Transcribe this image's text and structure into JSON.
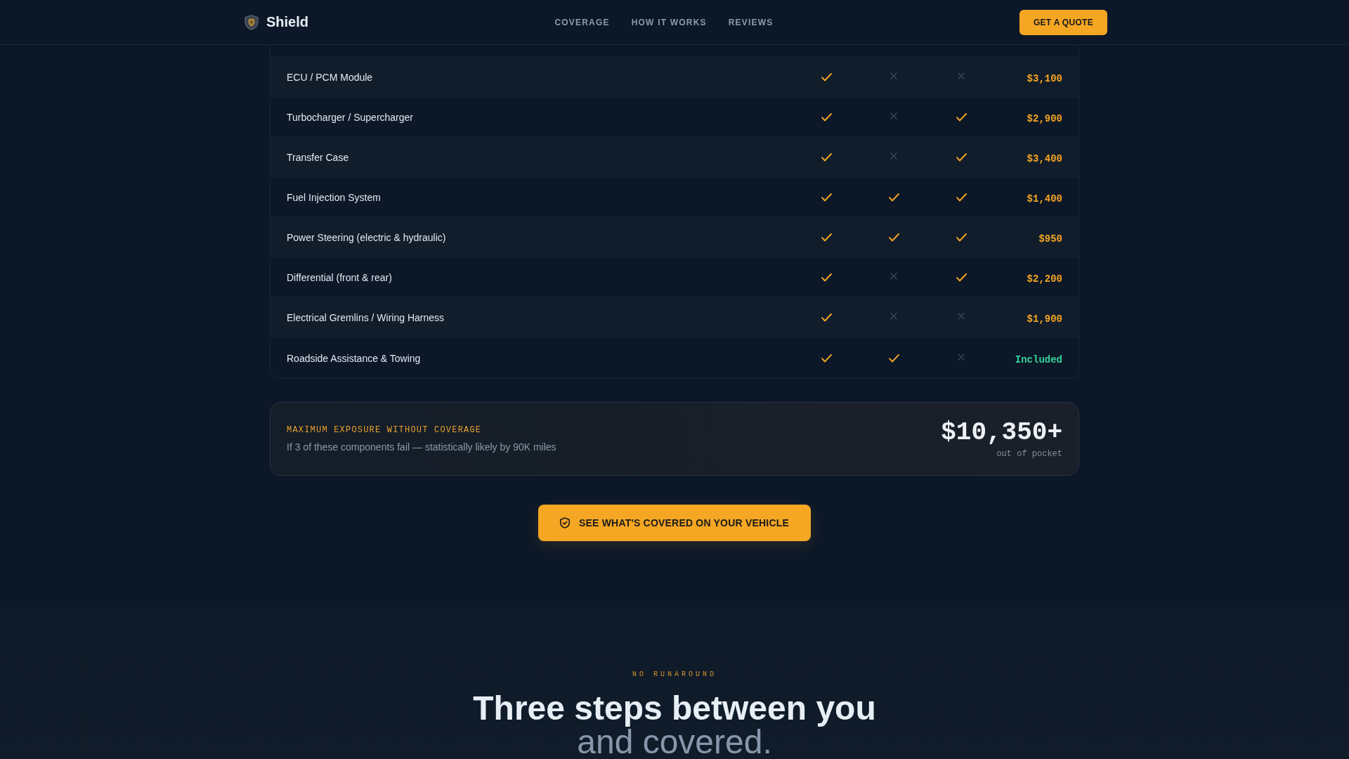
{
  "header": {
    "brand": "Shield",
    "nav": [
      {
        "label": "COVERAGE"
      },
      {
        "label": "HOW IT WORKS"
      },
      {
        "label": "REVIEWS"
      }
    ],
    "cta": "GET A QUOTE"
  },
  "coverage_table": {
    "rows": [
      {
        "component": "ECU / PCM Module",
        "plans": [
          {
            "covered": true
          },
          {
            "covered": false
          },
          {
            "covered": false
          }
        ],
        "cost": {
          "kind": "amount",
          "text": "$3,100"
        }
      },
      {
        "component": "Turbocharger / Supercharger",
        "plans": [
          {
            "covered": true
          },
          {
            "covered": false
          },
          {
            "covered": true
          }
        ],
        "cost": {
          "kind": "amount",
          "text": "$2,900"
        }
      },
      {
        "component": "Transfer Case",
        "plans": [
          {
            "covered": true
          },
          {
            "covered": false
          },
          {
            "covered": true
          }
        ],
        "cost": {
          "kind": "amount",
          "text": "$3,400"
        }
      },
      {
        "component": "Fuel Injection System",
        "plans": [
          {
            "covered": true
          },
          {
            "covered": true
          },
          {
            "covered": true
          }
        ],
        "cost": {
          "kind": "amount",
          "text": "$1,400"
        }
      },
      {
        "component": "Power Steering (electric & hydraulic)",
        "plans": [
          {
            "covered": true
          },
          {
            "covered": true
          },
          {
            "covered": true
          }
        ],
        "cost": {
          "kind": "amount",
          "text": "$950"
        }
      },
      {
        "component": "Differential (front & rear)",
        "plans": [
          {
            "covered": true
          },
          {
            "covered": false
          },
          {
            "covered": true
          }
        ],
        "cost": {
          "kind": "amount",
          "text": "$2,200"
        }
      },
      {
        "component": "Electrical Gremlins / Wiring Harness",
        "plans": [
          {
            "covered": true
          },
          {
            "covered": false
          },
          {
            "covered": false
          }
        ],
        "cost": {
          "kind": "amount",
          "text": "$1,900"
        }
      },
      {
        "component": "Roadside Assistance & Towing",
        "plans": [
          {
            "covered": true
          },
          {
            "covered": true
          },
          {
            "covered": false
          }
        ],
        "cost": {
          "kind": "included",
          "text": "Included"
        }
      }
    ]
  },
  "exposure": {
    "label": "MAXIMUM EXPOSURE WITHOUT COVERAGE",
    "note": "If 3 of these components fail — statistically likely by 90K miles",
    "amount": "$10,350+",
    "caption": "out of pocket"
  },
  "cta": {
    "label": "SEE WHAT'S COVERED ON YOUR VEHICLE"
  },
  "steps_intro": {
    "eyebrow": "NO RUNAROUND",
    "title": "Three steps between you",
    "title_accent": "and covered."
  }
}
